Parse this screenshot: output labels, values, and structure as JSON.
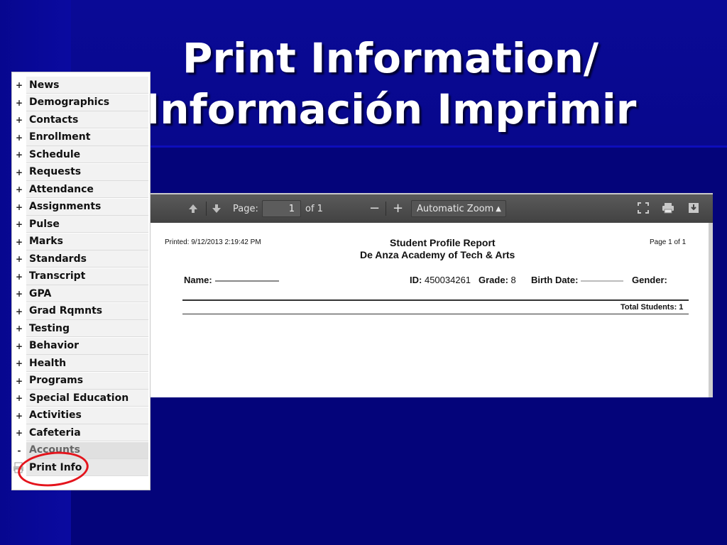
{
  "title": {
    "line1": "Print Information/",
    "line2": "Información Imprimir"
  },
  "sidebar": {
    "items": [
      {
        "expander": "+",
        "label": "News"
      },
      {
        "expander": "+",
        "label": "Demographics"
      },
      {
        "expander": "+",
        "label": "Contacts"
      },
      {
        "expander": "+",
        "label": "Enrollment"
      },
      {
        "expander": "+",
        "label": "Schedule"
      },
      {
        "expander": "+",
        "label": "Requests"
      },
      {
        "expander": "+",
        "label": "Attendance"
      },
      {
        "expander": "+",
        "label": "Assignments"
      },
      {
        "expander": "+",
        "label": "Pulse"
      },
      {
        "expander": "+",
        "label": "Marks"
      },
      {
        "expander": "+",
        "label": "Standards"
      },
      {
        "expander": "+",
        "label": "Transcript"
      },
      {
        "expander": "+",
        "label": "GPA"
      },
      {
        "expander": "+",
        "label": "Grad Rqmnts"
      },
      {
        "expander": "+",
        "label": "Testing"
      },
      {
        "expander": "+",
        "label": "Behavior"
      },
      {
        "expander": "+",
        "label": "Health"
      },
      {
        "expander": "+",
        "label": "Programs"
      },
      {
        "expander": "+",
        "label": "Special Education"
      },
      {
        "expander": "+",
        "label": "Activities"
      },
      {
        "expander": "+",
        "label": "Cafeteria"
      },
      {
        "expander": "-",
        "label": "Accounts"
      }
    ],
    "sub_item": {
      "label": "Print Info",
      "icon": "printer-icon"
    },
    "highlight_color": "#e4141c"
  },
  "viewer": {
    "page_label": "Page:",
    "page_value": "1",
    "page_of": "of 1",
    "zoom_minus": "−",
    "zoom_plus": "+",
    "zoom_value": "Automatic Zoom",
    "icons": [
      "up-arrow-icon",
      "down-arrow-icon",
      "fullscreen-icon",
      "print-icon",
      "download-icon"
    ]
  },
  "report": {
    "printed": "Printed: 9/12/2013 2:19:42 PM",
    "title": "Student Profile Report",
    "school": "De Anza Academy of Tech & Arts",
    "page": "Page 1 of 1",
    "name_label": "Name:",
    "id_label": "ID:",
    "id_value": "450034261",
    "grade_label": "Grade:",
    "grade_value": "8",
    "birth_label": "Birth Date:",
    "gender_label": "Gender:",
    "total": "Total Students: 1"
  }
}
